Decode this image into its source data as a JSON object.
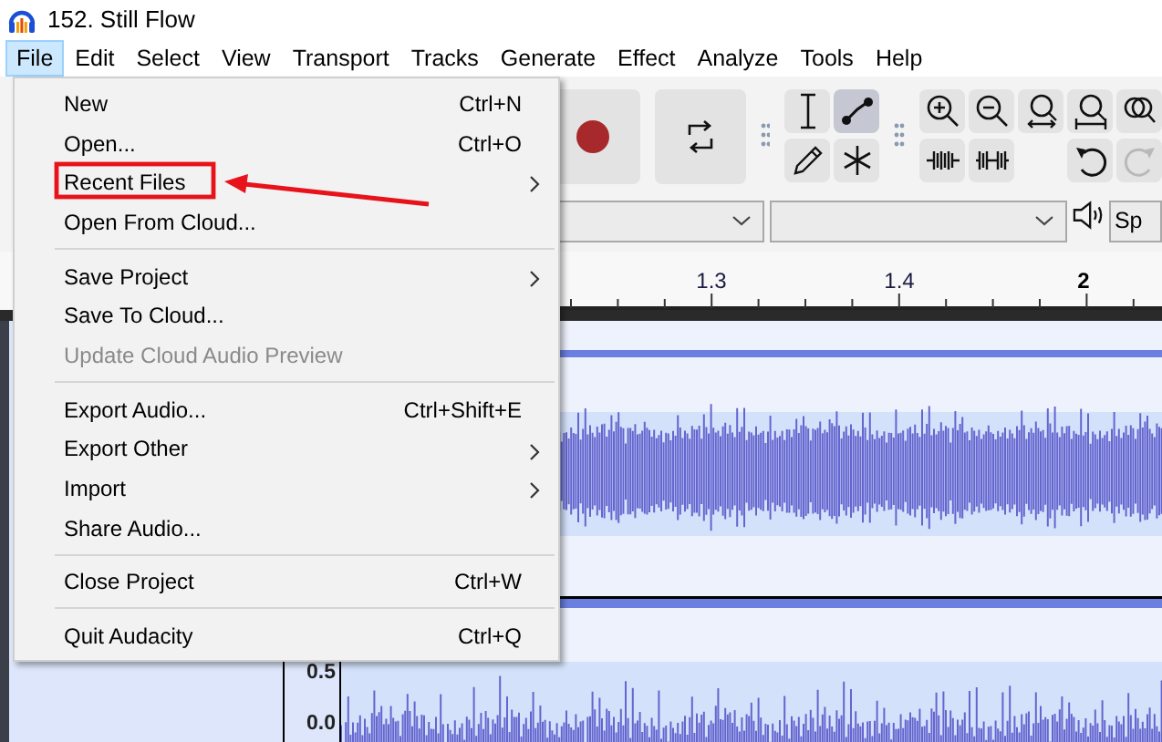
{
  "window": {
    "title": "152. Still Flow"
  },
  "menu_bar": [
    {
      "label": "File",
      "selected": true
    },
    {
      "label": "Edit",
      "selected": false
    },
    {
      "label": "Select",
      "selected": false
    },
    {
      "label": "View",
      "selected": false
    },
    {
      "label": "Transport",
      "selected": false
    },
    {
      "label": "Tracks",
      "selected": false
    },
    {
      "label": "Generate",
      "selected": false
    },
    {
      "label": "Effect",
      "selected": false
    },
    {
      "label": "Analyze",
      "selected": false
    },
    {
      "label": "Tools",
      "selected": false
    },
    {
      "label": "Help",
      "selected": false
    }
  ],
  "file_menu": [
    {
      "kind": "item",
      "label": "New",
      "shortcut": "Ctrl+N",
      "disabled": false,
      "annotated": false
    },
    {
      "kind": "item",
      "label": "Open...",
      "shortcut": "Ctrl+O",
      "disabled": false,
      "annotated": false
    },
    {
      "kind": "submenu",
      "label": "Recent Files",
      "disabled": false,
      "annotated": true
    },
    {
      "kind": "item",
      "label": "Open From Cloud...",
      "disabled": false,
      "annotated": false
    },
    {
      "kind": "separator"
    },
    {
      "kind": "submenu",
      "label": "Save Project",
      "disabled": false,
      "annotated": false
    },
    {
      "kind": "item",
      "label": "Save To Cloud...",
      "disabled": false,
      "annotated": false
    },
    {
      "kind": "item",
      "label": "Update Cloud Audio Preview",
      "disabled": true,
      "annotated": false
    },
    {
      "kind": "separator"
    },
    {
      "kind": "item",
      "label": "Export Audio...",
      "shortcut": "Ctrl+Shift+E",
      "disabled": false,
      "annotated": false
    },
    {
      "kind": "submenu",
      "label": "Export Other",
      "disabled": false,
      "annotated": false
    },
    {
      "kind": "submenu",
      "label": "Import",
      "disabled": false,
      "annotated": false
    },
    {
      "kind": "item",
      "label": "Share Audio...",
      "disabled": false,
      "annotated": false
    },
    {
      "kind": "separator"
    },
    {
      "kind": "item",
      "label": "Close Project",
      "shortcut": "Ctrl+W",
      "disabled": false,
      "annotated": false
    },
    {
      "kind": "separator"
    },
    {
      "kind": "item",
      "label": "Quit Audacity",
      "shortcut": "Ctrl+Q",
      "disabled": false,
      "annotated": false
    }
  ],
  "transport_buttons": [
    {
      "kind": "record"
    },
    {
      "kind": "loop"
    }
  ],
  "tools": [
    {
      "kind": "select",
      "selected": false
    },
    {
      "kind": "envelope",
      "selected": true
    },
    {
      "kind": "draw",
      "selected": false
    },
    {
      "kind": "multi",
      "selected": false
    }
  ],
  "zoom_buttons": [
    {
      "kind": "zoom-in"
    },
    {
      "kind": "zoom-out"
    },
    {
      "kind": "fit-selection"
    },
    {
      "kind": "fit-project"
    },
    {
      "kind": "zoom-toggle"
    }
  ],
  "edit_buttons": [
    {
      "kind": "trim"
    },
    {
      "kind": "silence"
    }
  ],
  "history_buttons": [
    {
      "kind": "undo",
      "disabled": false
    },
    {
      "kind": "redo",
      "disabled": true
    }
  ],
  "device_bar": {
    "output_label": "Sp"
  },
  "timeline": [
    {
      "label": "1.3",
      "major": false
    },
    {
      "label": "1.4",
      "major": false
    },
    {
      "label": "2",
      "major": true
    }
  ],
  "vertical_ruler": [
    "0.5",
    "0.0"
  ]
}
